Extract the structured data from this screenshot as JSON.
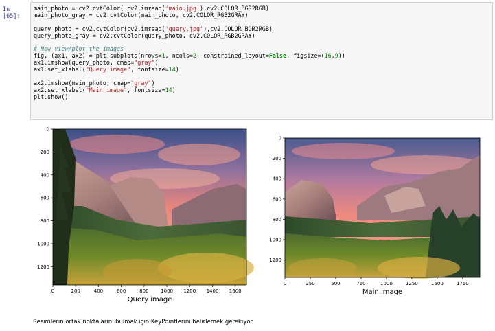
{
  "cell": {
    "prompt": "In [65]:",
    "code_lines": [
      [
        {
          "t": "main_photo = cv2.cvtColor( cv2.imread("
        },
        {
          "t": "'main.jpg'",
          "c": "str"
        },
        {
          "t": "),cv2.COLOR_BGR2RGB)"
        }
      ],
      [
        {
          "t": "main_photo_gray = cv2.cvtColor(main_photo, cv2.COLOR_RGB2GRAY)"
        }
      ],
      [
        {
          "t": ""
        }
      ],
      [
        {
          "t": "query_photo = cv2.cvtColor(cv2.imread("
        },
        {
          "t": "'query.jpg'",
          "c": "str"
        },
        {
          "t": "),cv2.COLOR_BGR2RGB)"
        }
      ],
      [
        {
          "t": "query_photo_gray = cv2.cvtColor(query_photo, cv2.COLOR_RGB2GRAY)"
        }
      ],
      [
        {
          "t": ""
        }
      ],
      [
        {
          "t": "# Now view/plot the images",
          "c": "cm"
        }
      ],
      [
        {
          "t": "fig, (ax1, ax2) = plt.subplots(nrows="
        },
        {
          "t": "1",
          "c": "num"
        },
        {
          "t": ", ncols="
        },
        {
          "t": "2",
          "c": "num"
        },
        {
          "t": ", constrained_layout="
        },
        {
          "t": "False",
          "c": "kw"
        },
        {
          "t": ", figsize=("
        },
        {
          "t": "16",
          "c": "num"
        },
        {
          "t": ","
        },
        {
          "t": "9",
          "c": "num"
        },
        {
          "t": "))"
        }
      ],
      [
        {
          "t": "ax1.imshow(query_photo, cmap="
        },
        {
          "t": "\"gray\"",
          "c": "str"
        },
        {
          "t": ")"
        }
      ],
      [
        {
          "t": "ax1.set_xlabel("
        },
        {
          "t": "\"Query image\"",
          "c": "str"
        },
        {
          "t": ", fontsize="
        },
        {
          "t": "14",
          "c": "num"
        },
        {
          "t": ")"
        }
      ],
      [
        {
          "t": ""
        }
      ],
      [
        {
          "t": "ax2.imshow(main_photo, cmap="
        },
        {
          "t": "\"gray\"",
          "c": "str"
        },
        {
          "t": ")"
        }
      ],
      [
        {
          "t": "ax2.set_xlabel("
        },
        {
          "t": "\"Main image\"",
          "c": "str"
        },
        {
          "t": ", fontsize="
        },
        {
          "t": "14",
          "c": "num"
        },
        {
          "t": ")"
        }
      ],
      [
        {
          "t": "plt.show()"
        }
      ]
    ]
  },
  "plots": [
    {
      "name": "query",
      "xlabel": "Query image",
      "xticks": [
        "0",
        "200",
        "400",
        "600",
        "800",
        "1000",
        "1200",
        "1400",
        "1600"
      ],
      "yticks": [
        "0",
        "200",
        "400",
        "600",
        "800",
        "1000",
        "1200"
      ]
    },
    {
      "name": "main",
      "xlabel": "Main image",
      "xticks": [
        "0",
        "250",
        "500",
        "750",
        "1000",
        "1250",
        "1500",
        "1750"
      ],
      "yticks": [
        "0",
        "200",
        "400",
        "600",
        "800",
        "1000",
        "1200"
      ]
    }
  ],
  "markdown": {
    "text": "Resimlerin ortak noktalarını bulmak için KeyPointlerini belirlemek gerekiyor"
  },
  "colors": {
    "prompt": "#303f9f",
    "string": "#ba2121",
    "number": "#008800",
    "keyword": "#008000",
    "comment": "#408080"
  }
}
